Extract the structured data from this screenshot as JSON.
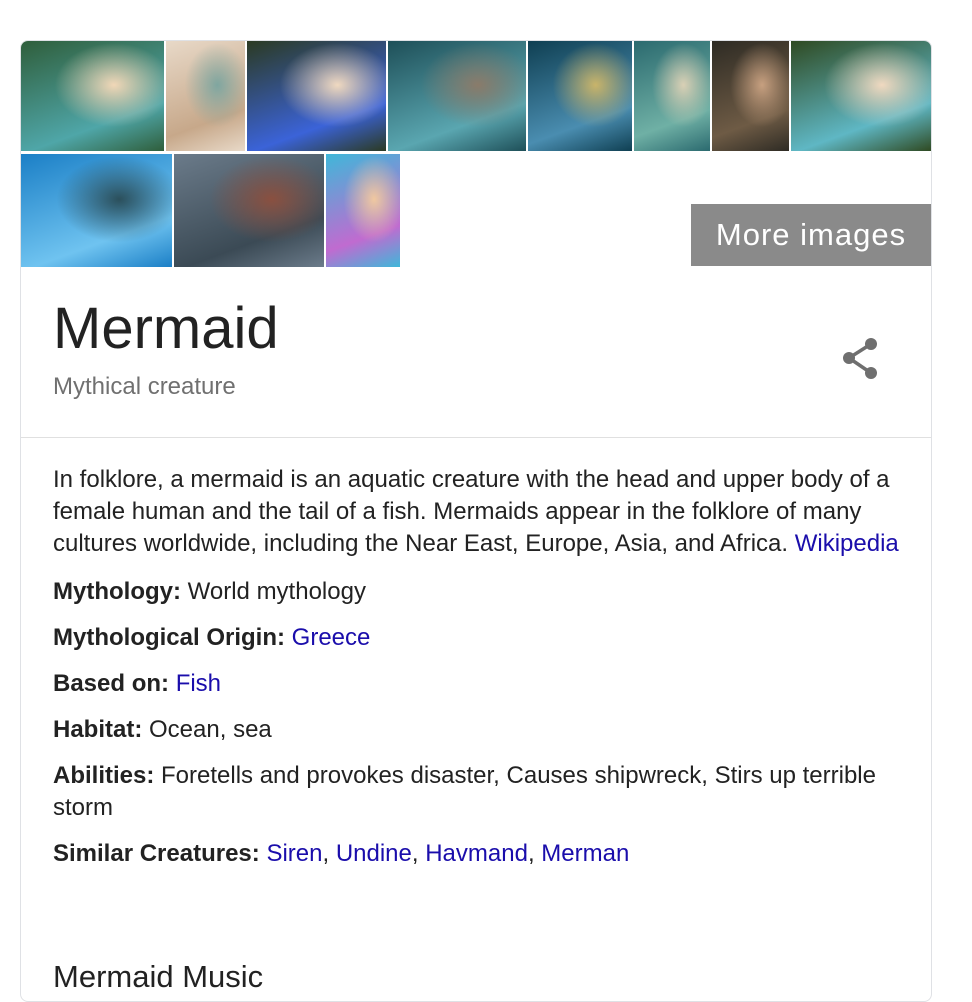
{
  "images": {
    "more_label": "More images",
    "thumbs": [
      {
        "name": "mermaid-photo-1",
        "colors": [
          "#2f5e3b",
          "#4fa6a8",
          "#f1d7b7"
        ]
      },
      {
        "name": "mermaid-illustration-vintage",
        "colors": [
          "#e8d9c8",
          "#c7a88a",
          "#7fa6a0"
        ]
      },
      {
        "name": "mermaid-photo-blue-tail",
        "colors": [
          "#2b3a22",
          "#3b63d8",
          "#f0d9c0"
        ]
      },
      {
        "name": "manatee-photo",
        "colors": [
          "#1e4f58",
          "#5aa6b0",
          "#8a7b6a"
        ]
      },
      {
        "name": "mermaid-statue-rock",
        "colors": [
          "#0f3f52",
          "#4a8db0",
          "#c9b46a"
        ]
      },
      {
        "name": "mermaid-painting-waves",
        "colors": [
          "#2b6a6f",
          "#6fb0a5",
          "#d9d0b5"
        ]
      },
      {
        "name": "mermaid-painting-classic",
        "colors": [
          "#2e2b24",
          "#6e5b45",
          "#c7a080"
        ]
      },
      {
        "name": "mermaid-photo-green-tail",
        "colors": [
          "#2f4a22",
          "#5fb7c4",
          "#f0d9c0"
        ]
      },
      {
        "name": "mermaid-underwater-photo",
        "colors": [
          "#1b7fc6",
          "#6fc3f0",
          "#2b4f5b"
        ]
      },
      {
        "name": "mermaid-statue-beach",
        "colors": [
          "#6b7b8a",
          "#3b4a55",
          "#8a5040"
        ]
      },
      {
        "name": "girls-mermaid-tails-photo",
        "colors": [
          "#3fb7d9",
          "#c06bd0",
          "#f0c8a0"
        ]
      }
    ]
  },
  "entity": {
    "title": "Mermaid",
    "subtitle": "Mythical creature"
  },
  "description": {
    "text": "In folklore, a mermaid is an aquatic creature with the head and upper body of a female human and the tail of a fish. Mermaids appear in the folklore of many cultures worldwide, including the Near East, Europe, Asia, and Africa. ",
    "source_link": "Wikipedia"
  },
  "facts": {
    "mythology": {
      "label": "Mythology:",
      "value": "World mythology"
    },
    "origin": {
      "label": "Mythological Origin:",
      "value": "Greece"
    },
    "based_on": {
      "label": "Based on:",
      "value": "Fish"
    },
    "habitat": {
      "label": "Habitat:",
      "value": "Ocean, sea"
    },
    "abilities": {
      "label": "Abilities:",
      "value": "Foretells and provokes disaster, Causes shipwreck, Stirs up terrible storm"
    },
    "similar": {
      "label": "Similar Creatures:",
      "links": [
        "Siren",
        "Undine",
        "Havmand",
        "Merman"
      ],
      "separator": ", "
    }
  },
  "next_section": {
    "heading": "Mermaid Music"
  },
  "colors": {
    "link": "#1a0dab",
    "text": "#222222",
    "muted": "#707070",
    "overlay": "#8a8a8a"
  }
}
